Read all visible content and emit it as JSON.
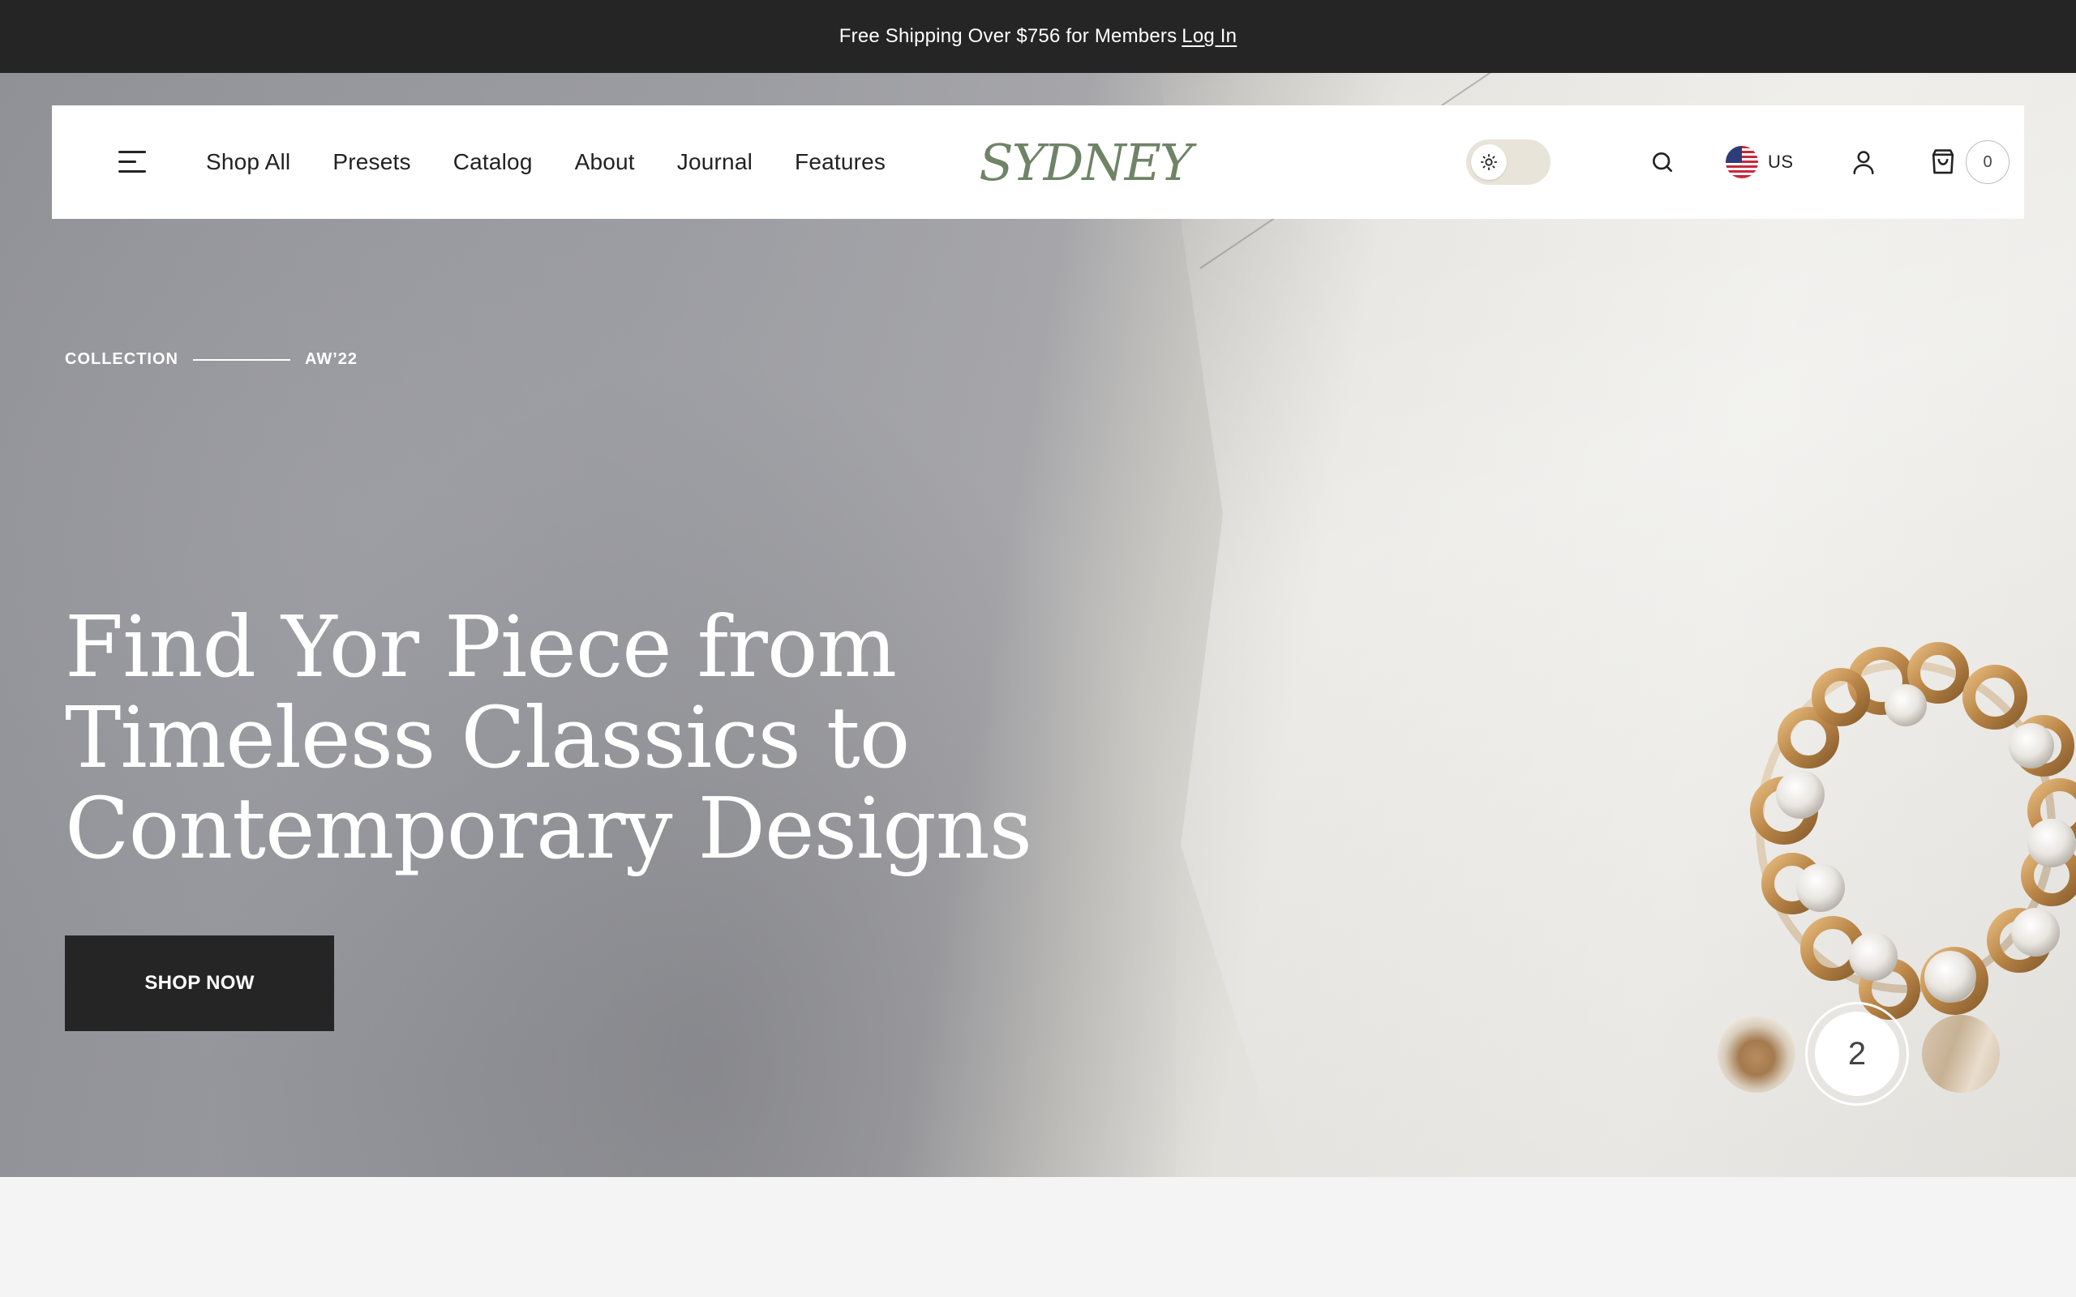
{
  "announcement": {
    "text": "Free Shipping Over $756 for Members",
    "link": "Log In"
  },
  "nav": {
    "menu_icon": "hamburger-menu-icon",
    "items": [
      {
        "label": "Shop All"
      },
      {
        "label": "Presets"
      },
      {
        "label": "Catalog"
      },
      {
        "label": "About"
      },
      {
        "label": "Journal"
      },
      {
        "label": "Features"
      }
    ],
    "logo": "SYDNEY",
    "theme_toggle_icon": "sun-icon",
    "search_icon": "search-icon",
    "locale": {
      "flag": "us-flag-icon",
      "label": "US"
    },
    "account_icon": "user-icon",
    "cart_icon": "shopping-bag-icon",
    "cart_count": "0"
  },
  "hero": {
    "eyebrow_left": "COLLECTION",
    "eyebrow_right": "AW’22",
    "headline_lines": [
      "Find Yor Piece from",
      "Timeless Classics to",
      "Contemporary Designs"
    ],
    "cta_label": "SHOP NOW",
    "active_slide": "2"
  },
  "colors": {
    "announcement_bg": "#252525",
    "logo": "#6f8466",
    "toggle_bg": "#e8e4d9",
    "cta_bg": "#252525",
    "page_bg": "#f4f4f4"
  }
}
